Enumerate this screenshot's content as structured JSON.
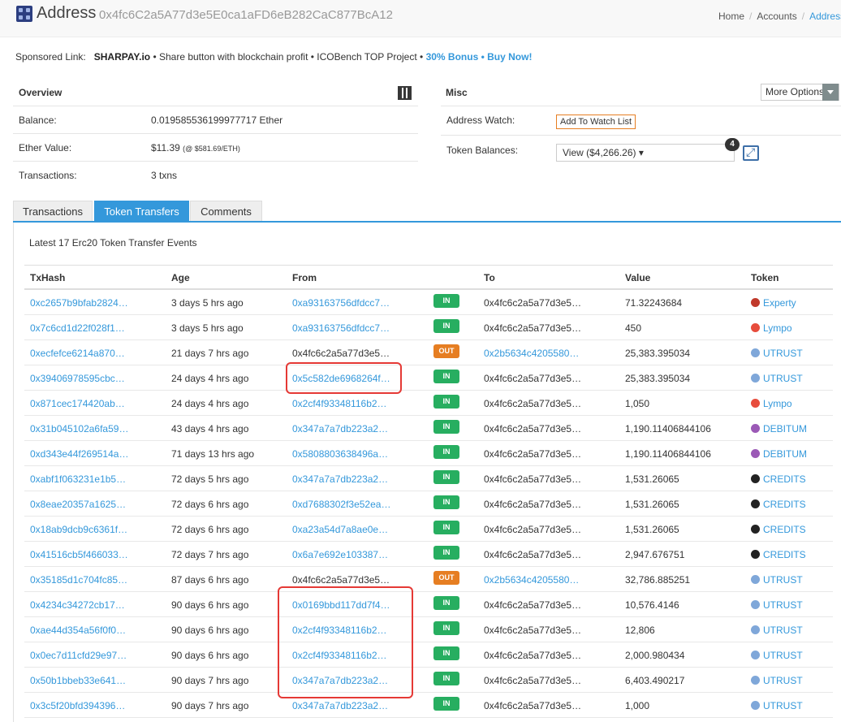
{
  "header": {
    "title": "Address",
    "address": "0x4fc6C2a5A77d3e5E0ca1aFD6eB282CaC877BcA12",
    "breadcrumb": [
      "Home",
      "Accounts",
      "Address"
    ]
  },
  "sponsored": {
    "label": "Sponsored Link:",
    "brand": "SHARPAY.io",
    "text": " • Share button with blockchain profit • ICOBench TOP Project • ",
    "bonus": "30% Bonus • Buy Now!"
  },
  "overview": {
    "title": "Overview",
    "balance_label": "Balance:",
    "balance_value": "0.019585536199977717 Ether",
    "ether_value_label": "Ether Value:",
    "ether_value": "$11.39",
    "ether_rate": "(@ $581.69/ETH)",
    "transactions_label": "Transactions:",
    "transactions_value": "3 txns"
  },
  "misc": {
    "title": "Misc",
    "more_options": "More Options",
    "address_watch_label": "Address Watch:",
    "watch_button": "Add To Watch List",
    "token_balances_label": "Token Balances:",
    "token_dropdown": "View ($4,266.26) ▾",
    "token_count": "4"
  },
  "tabs": [
    "Transactions",
    "Token Transfers",
    "Comments"
  ],
  "caption": "Latest 17 Erc20 Token Transfer Events",
  "table": {
    "headers": [
      "TxHash",
      "Age",
      "From",
      "To",
      "Value",
      "Token"
    ],
    "rows": [
      {
        "hash": "0xc2657b9bfab2824…",
        "age": "3 days 5 hrs ago",
        "from": "0xa93163756dfdcc7…",
        "from_link": true,
        "dir": "IN",
        "to": "0x4fc6c2a5a77d3e5…",
        "to_link": false,
        "value": "71.32243684",
        "token": "Experty",
        "color": "#c0392b"
      },
      {
        "hash": "0x7c6cd1d22f028f1…",
        "age": "3 days 5 hrs ago",
        "from": "0xa93163756dfdcc7…",
        "from_link": true,
        "dir": "IN",
        "to": "0x4fc6c2a5a77d3e5…",
        "to_link": false,
        "value": "450",
        "token": "Lympo",
        "color": "#e74c3c"
      },
      {
        "hash": "0xecfefce6214a870…",
        "age": "21 days 7 hrs ago",
        "from": "0x4fc6c2a5a77d3e5…",
        "from_link": false,
        "dir": "OUT",
        "to": "0x2b5634c4205580…",
        "to_link": true,
        "value": "25,383.395034",
        "token": "UTRUST",
        "color": "#7fa7d9"
      },
      {
        "hash": "0x39406978595cbc…",
        "age": "24 days 4 hrs ago",
        "from": "0x5c582de6968264f…",
        "from_link": true,
        "dir": "IN",
        "to": "0x4fc6c2a5a77d3e5…",
        "to_link": false,
        "value": "25,383.395034",
        "token": "UTRUST",
        "color": "#7fa7d9"
      },
      {
        "hash": "0x871cec174420ab…",
        "age": "24 days 4 hrs ago",
        "from": "0x2cf4f93348116b2…",
        "from_link": true,
        "dir": "IN",
        "to": "0x4fc6c2a5a77d3e5…",
        "to_link": false,
        "value": "1,050",
        "token": "Lympo",
        "color": "#e74c3c"
      },
      {
        "hash": "0x31b045102a6fa59…",
        "age": "43 days 4 hrs ago",
        "from": "0x347a7a7db223a2…",
        "from_link": true,
        "dir": "IN",
        "to": "0x4fc6c2a5a77d3e5…",
        "to_link": false,
        "value": "1,190.11406844106",
        "token": "DEBITUM",
        "color": "#9b59b6"
      },
      {
        "hash": "0xd343e44f269514a…",
        "age": "71 days 13 hrs ago",
        "from": "0x5808803638496a…",
        "from_link": true,
        "dir": "IN",
        "to": "0x4fc6c2a5a77d3e5…",
        "to_link": false,
        "value": "1,190.11406844106",
        "token": "DEBITUM",
        "color": "#9b59b6"
      },
      {
        "hash": "0xabf1f063231e1b5…",
        "age": "72 days 5 hrs ago",
        "from": "0x347a7a7db223a2…",
        "from_link": true,
        "dir": "IN",
        "to": "0x4fc6c2a5a77d3e5…",
        "to_link": false,
        "value": "1,531.26065",
        "token": "CREDITS",
        "color": "#222222"
      },
      {
        "hash": "0x8eae20357a1625…",
        "age": "72 days 6 hrs ago",
        "from": "0xd7688302f3e52ea…",
        "from_link": true,
        "dir": "IN",
        "to": "0x4fc6c2a5a77d3e5…",
        "to_link": false,
        "value": "1,531.26065",
        "token": "CREDITS",
        "color": "#222222"
      },
      {
        "hash": "0x18ab9dcb9c6361f…",
        "age": "72 days 6 hrs ago",
        "from": "0xa23a54d7a8ae0e…",
        "from_link": true,
        "dir": "IN",
        "to": "0x4fc6c2a5a77d3e5…",
        "to_link": false,
        "value": "1,531.26065",
        "token": "CREDITS",
        "color": "#222222"
      },
      {
        "hash": "0x41516cb5f466033…",
        "age": "72 days 7 hrs ago",
        "from": "0x6a7e692e103387…",
        "from_link": true,
        "dir": "IN",
        "to": "0x4fc6c2a5a77d3e5…",
        "to_link": false,
        "value": "2,947.676751",
        "token": "CREDITS",
        "color": "#222222"
      },
      {
        "hash": "0x35185d1c704fc85…",
        "age": "87 days 6 hrs ago",
        "from": "0x4fc6c2a5a77d3e5…",
        "from_link": false,
        "dir": "OUT",
        "to": "0x2b5634c4205580…",
        "to_link": true,
        "value": "32,786.885251",
        "token": "UTRUST",
        "color": "#7fa7d9"
      },
      {
        "hash": "0x4234c34272cb17…",
        "age": "90 days 6 hrs ago",
        "from": "0x0169bbd117dd7f4…",
        "from_link": true,
        "dir": "IN",
        "to": "0x4fc6c2a5a77d3e5…",
        "to_link": false,
        "value": "10,576.4146",
        "token": "UTRUST",
        "color": "#7fa7d9"
      },
      {
        "hash": "0xae44d354a56f0f0…",
        "age": "90 days 6 hrs ago",
        "from": "0x2cf4f93348116b2…",
        "from_link": true,
        "dir": "IN",
        "to": "0x4fc6c2a5a77d3e5…",
        "to_link": false,
        "value": "12,806",
        "token": "UTRUST",
        "color": "#7fa7d9"
      },
      {
        "hash": "0x0ec7d11cfd29e97…",
        "age": "90 days 6 hrs ago",
        "from": "0x2cf4f93348116b2…",
        "from_link": true,
        "dir": "IN",
        "to": "0x4fc6c2a5a77d3e5…",
        "to_link": false,
        "value": "2,000.980434",
        "token": "UTRUST",
        "color": "#7fa7d9"
      },
      {
        "hash": "0x50b1bbeb33e641…",
        "age": "90 days 7 hrs ago",
        "from": "0x347a7a7db223a2…",
        "from_link": true,
        "dir": "IN",
        "to": "0x4fc6c2a5a77d3e5…",
        "to_link": false,
        "value": "6,403.490217",
        "token": "UTRUST",
        "color": "#7fa7d9"
      },
      {
        "hash": "0x3c5f20bfd394396…",
        "age": "90 days 7 hrs ago",
        "from": "0x347a7a7db223a2…",
        "from_link": true,
        "dir": "IN",
        "to": "0x4fc6c2a5a77d3e5…",
        "to_link": false,
        "value": "1,000",
        "token": "UTRUST",
        "color": "#7fa7d9"
      }
    ]
  }
}
